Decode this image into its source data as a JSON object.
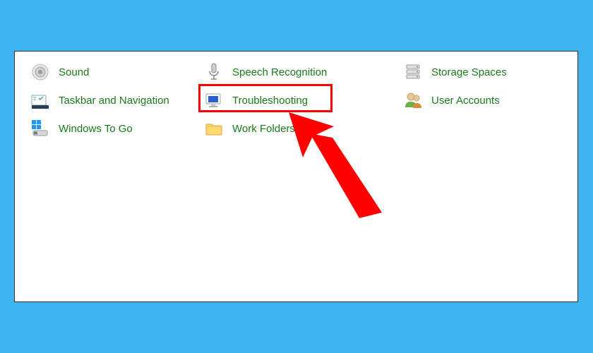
{
  "items": {
    "sound": {
      "label": "Sound"
    },
    "speech_recognition": {
      "label": "Speech Recognition"
    },
    "storage_spaces": {
      "label": "Storage Spaces"
    },
    "taskbar_navigation": {
      "label": "Taskbar and Navigation"
    },
    "troubleshooting": {
      "label": "Troubleshooting"
    },
    "user_accounts": {
      "label": "User Accounts"
    },
    "windows_to_go": {
      "label": "Windows To Go"
    },
    "work_folders": {
      "label": "Work Folders"
    }
  },
  "highlight": {
    "target": "troubleshooting",
    "color": "#ff0000"
  }
}
